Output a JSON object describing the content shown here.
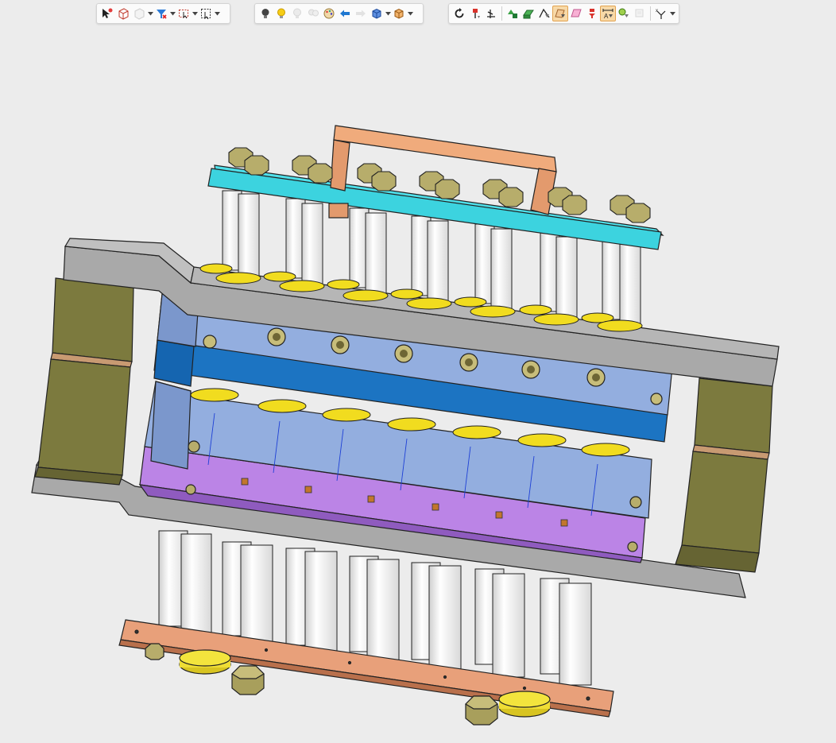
{
  "colors": {
    "background": "#ececec",
    "toolbar_bg": "#fbfbfb",
    "frame_grey": "#a9a9a9",
    "block_olive": "#7c7a3e",
    "upper_plate_cyan": "#3cd3df",
    "handle_copper": "#e39a6d",
    "die_light_blue": "#93aedf",
    "die_dark_blue": "#1c74c2",
    "purple_plate": "#bb84e6",
    "washer_yellow": "#f1dc1f",
    "hex_nut": "#b7ad6b",
    "pillar_white": "#f6f6f6",
    "bottom_plate_copper": "#e8a07a",
    "active_button_bg": "#f7d9a8"
  },
  "toolbars": [
    {
      "name": "selection-toolbar",
      "items": [
        {
          "type": "button",
          "name": "select-arrow-icon",
          "glyph": "select",
          "interactable": true
        },
        {
          "type": "button",
          "name": "select-3d-box-icon",
          "glyph": "box-select",
          "interactable": true
        },
        {
          "type": "button",
          "name": "pre-highlight-icon",
          "glyph": "ghost-box",
          "interactable": true,
          "disabled": true
        },
        {
          "type": "caret",
          "name": "pre-highlight-dropdown-caret"
        },
        {
          "type": "button",
          "name": "selection-filter-icon",
          "glyph": "filter",
          "interactable": true
        },
        {
          "type": "caret",
          "name": "selection-filter-dropdown-caret"
        },
        {
          "type": "button",
          "name": "box-select-icon",
          "glyph": "rect-select",
          "interactable": true
        },
        {
          "type": "caret",
          "name": "box-select-dropdown-caret"
        },
        {
          "type": "button",
          "name": "select-in-window-icon",
          "glyph": "rect-arrow",
          "interactable": true
        },
        {
          "type": "caret",
          "name": "select-in-window-dropdown-caret"
        }
      ]
    },
    {
      "name": "display-toolbar",
      "items": [
        {
          "type": "button",
          "name": "light-off-bulb-icon",
          "glyph": "bulb-dark",
          "interactable": true
        },
        {
          "type": "button",
          "name": "light-on-bulb-icon",
          "glyph": "bulb-yellow",
          "interactable": true
        },
        {
          "type": "button",
          "name": "light-disabled-bulb-icon",
          "glyph": "bulb-grey",
          "interactable": true,
          "disabled": true
        },
        {
          "type": "button",
          "name": "light-group-disabled-icon",
          "glyph": "bulb-pair",
          "interactable": true,
          "disabled": true
        },
        {
          "type": "button",
          "name": "render-style-icon",
          "glyph": "palette",
          "interactable": true
        },
        {
          "type": "button",
          "name": "back-arrow-icon",
          "glyph": "arrow-left",
          "interactable": true
        },
        {
          "type": "button",
          "name": "forward-arrow-icon",
          "glyph": "arrow-right",
          "interactable": true,
          "disabled": true
        },
        {
          "type": "button",
          "name": "view-cube-icon",
          "glyph": "cube-blue",
          "interactable": true
        },
        {
          "type": "caret",
          "name": "view-cube-dropdown-caret"
        },
        {
          "type": "button",
          "name": "view-orientation-icon",
          "glyph": "cube-orange",
          "interactable": true
        },
        {
          "type": "caret",
          "name": "view-orientation-dropdown-caret"
        }
      ]
    },
    {
      "name": "tools-toolbar",
      "items": [
        {
          "type": "button",
          "name": "rotate-icon",
          "glyph": "rotate",
          "interactable": true
        },
        {
          "type": "button",
          "name": "pin-filter-icon",
          "glyph": "pin-red",
          "interactable": true
        },
        {
          "type": "button",
          "name": "axis-filter-icon",
          "glyph": "axis",
          "interactable": true
        },
        {
          "type": "sep",
          "name": "tools-separator-1"
        },
        {
          "type": "button",
          "name": "shape-intersect-icon",
          "glyph": "shapes-green",
          "interactable": true
        },
        {
          "type": "button",
          "name": "shape-face-icon",
          "glyph": "shape-green",
          "interactable": true
        },
        {
          "type": "button",
          "name": "edge-filter-icon",
          "glyph": "edge",
          "interactable": true
        },
        {
          "type": "button",
          "name": "face-filter-active-icon",
          "glyph": "face-active",
          "interactable": true,
          "active": true
        },
        {
          "type": "button",
          "name": "plane-filter-icon",
          "glyph": "plane-pink",
          "interactable": true
        },
        {
          "type": "button",
          "name": "point-filter-icon",
          "glyph": "pin-red-funnel",
          "interactable": true
        },
        {
          "type": "button",
          "name": "dimension-filter-active-icon",
          "glyph": "dimension-active",
          "interactable": true,
          "active": true
        },
        {
          "type": "button",
          "name": "annotation-filter-icon",
          "glyph": "annotation",
          "interactable": true
        },
        {
          "type": "button",
          "name": "sketch-filter-disabled-icon",
          "glyph": "sketch-grey",
          "interactable": true,
          "disabled": true
        },
        {
          "type": "sep",
          "name": "tools-separator-2"
        },
        {
          "type": "button",
          "name": "coordinate-system-icon",
          "glyph": "coordinates",
          "interactable": true
        },
        {
          "type": "caret",
          "name": "coordinate-system-dropdown-caret"
        }
      ]
    }
  ],
  "model": {
    "name": "progressive-die-assembly",
    "visible_components": [
      "upper-stripper-plate",
      "lifting-handle",
      "upper-hex-nuts",
      "upper-guide-pillars",
      "upper-washers",
      "upper-frame-plate",
      "left-support-blocks",
      "right-support-blocks",
      "upper-die-block",
      "upper-die-shoe",
      "lower-die-block",
      "lower-punch-plate",
      "lower-frame-plate",
      "lower-guide-pillars",
      "bottom-base-plate",
      "bottom-feet",
      "bottom-hex-nuts"
    ]
  }
}
